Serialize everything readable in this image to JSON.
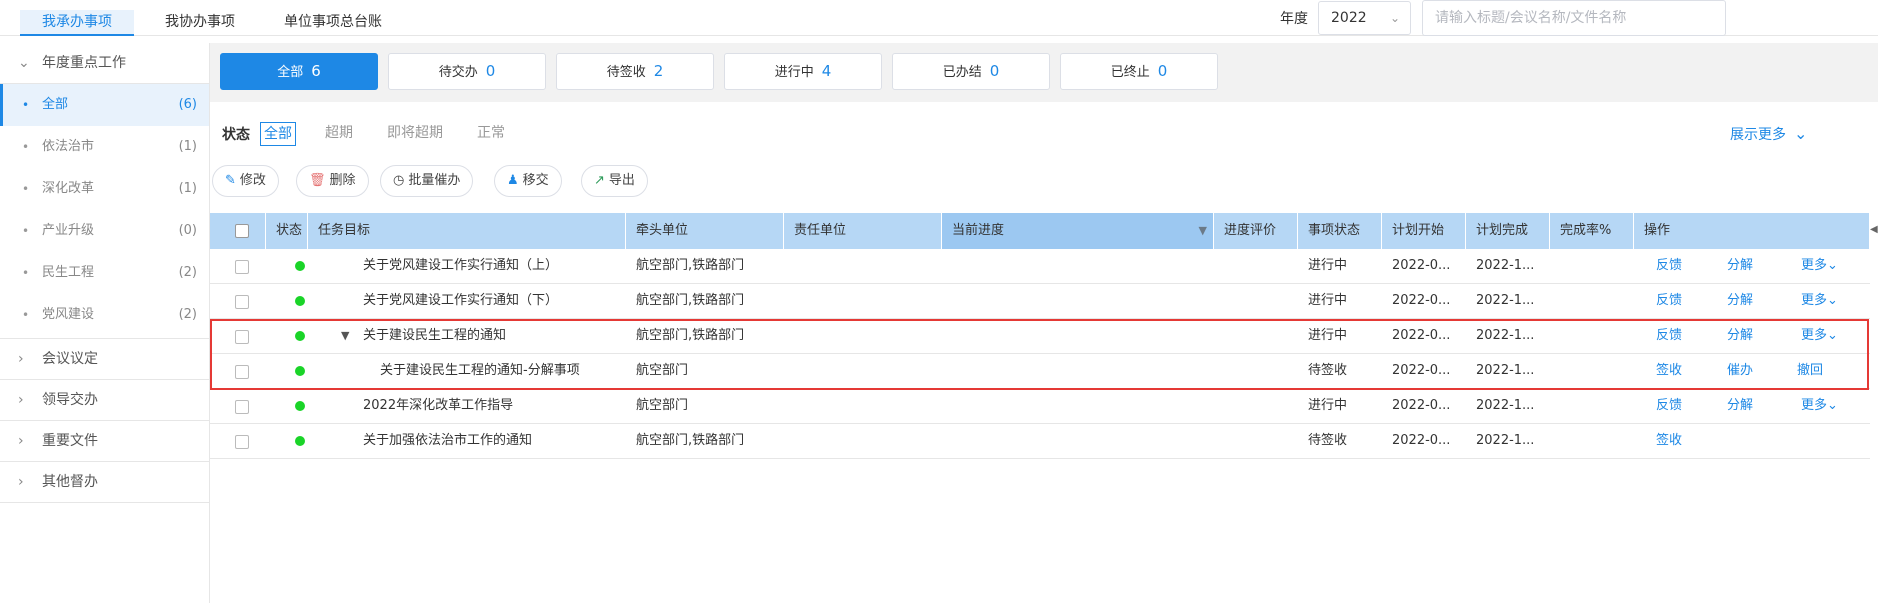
{
  "top_tabs": [
    {
      "label": "我承办事项",
      "active": true
    },
    {
      "label": "我协办事项",
      "active": false
    },
    {
      "label": "单位事项总台账",
      "active": false
    }
  ],
  "year": {
    "label": "年度",
    "value": "2022"
  },
  "search": {
    "placeholder": "请输入标题/会议名称/文件名称"
  },
  "sidebar": {
    "group_open": "年度重点工作",
    "items": [
      {
        "label": "全部",
        "count": "(6)",
        "active": true
      },
      {
        "label": "依法治市",
        "count": "(1)"
      },
      {
        "label": "深化改革",
        "count": "(1)"
      },
      {
        "label": "产业升级",
        "count": "(0)"
      },
      {
        "label": "民生工程",
        "count": "(2)"
      },
      {
        "label": "党风建设",
        "count": "(2)"
      }
    ],
    "groups": [
      "会议议定",
      "领导交办",
      "重要文件",
      "其他督办"
    ]
  },
  "summary": [
    {
      "label": "全部",
      "count": "6",
      "active": true
    },
    {
      "label": "待交办",
      "count": "0"
    },
    {
      "label": "待签收",
      "count": "2"
    },
    {
      "label": "进行中",
      "count": "4"
    },
    {
      "label": "已办结",
      "count": "0"
    },
    {
      "label": "已终止",
      "count": "0"
    }
  ],
  "status_filter": {
    "label": "状态",
    "options": [
      "全部",
      "超期",
      "即将超期",
      "正常"
    ],
    "show_more": "展示更多"
  },
  "actions": [
    {
      "label": "修改",
      "icon": "edit-icon"
    },
    {
      "label": "删除",
      "icon": "trash-icon"
    },
    {
      "label": "批量催办",
      "icon": "alarm-clock-icon"
    },
    {
      "label": "移交",
      "icon": "user-transfer-icon"
    },
    {
      "label": "导出",
      "icon": "export-icon"
    }
  ],
  "table": {
    "headers": [
      "状态",
      "任务目标",
      "牵头单位",
      "责任单位",
      "当前进度",
      "进度评价",
      "事项状态",
      "计划开始",
      "计划完成",
      "完成率%",
      "操作"
    ],
    "rows": [
      {
        "title": "关于党风建设工作实行通知（上）",
        "lead": "航空部门,铁路部门",
        "state": "进行中",
        "start": "2022-0...",
        "end": "2022-1...",
        "ops": [
          "反馈",
          "分解",
          "更多"
        ]
      },
      {
        "title": "关于党风建设工作实行通知（下）",
        "lead": "航空部门,铁路部门",
        "state": "进行中",
        "start": "2022-0...",
        "end": "2022-1...",
        "ops": [
          "反馈",
          "分解",
          "更多"
        ]
      },
      {
        "title": "关于建设民生工程的通知",
        "lead": "航空部门,铁路部门",
        "state": "进行中",
        "start": "2022-0...",
        "end": "2022-1...",
        "ops": [
          "反馈",
          "分解",
          "更多"
        ]
      },
      {
        "title": "关于建设民生工程的通知-分解事项",
        "lead": "航空部门",
        "state": "待签收",
        "start": "2022-0...",
        "end": "2022-1...",
        "ops": [
          "签收",
          "催办",
          "撤回"
        ]
      },
      {
        "title": "2022年深化改革工作指导",
        "lead": "航空部门",
        "state": "进行中",
        "start": "2022-0...",
        "end": "2022-1...",
        "ops": [
          "反馈",
          "分解",
          "更多"
        ]
      },
      {
        "title": "关于加强依法治市工作的通知",
        "lead": "航空部门,铁路部门",
        "state": "待签收",
        "start": "2022-0...",
        "end": "2022-1...",
        "ops": [
          "签收"
        ]
      }
    ]
  },
  "colors": {
    "accent": "#1e88e5",
    "header_bg": "#b6d7f5",
    "status_dot": "#1ad428",
    "highlight": "#e53935"
  }
}
